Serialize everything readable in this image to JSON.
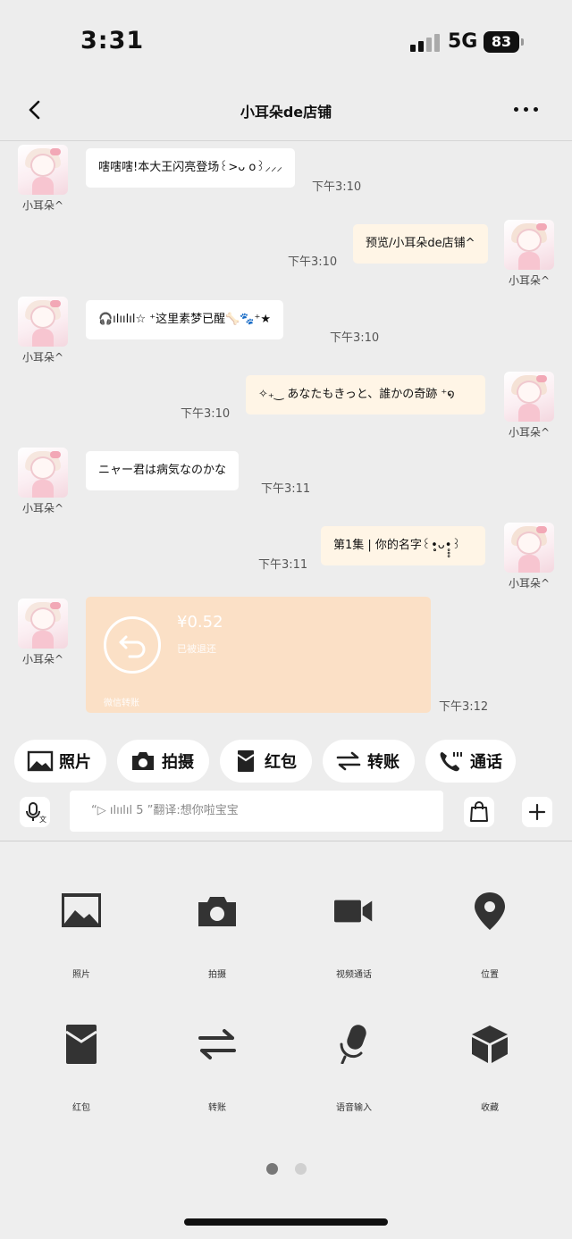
{
  "status": {
    "time": "3:31",
    "network": "5G",
    "battery": "83"
  },
  "nav": {
    "title": "小耳朵de店铺"
  },
  "messages": [
    {
      "side": "in",
      "name": "小耳朵^",
      "text": "嗐嗐嗐!本大王闪亮登场꒰>ᴗ o꒱⸝⸝⸝",
      "time": "下午3:10"
    },
    {
      "side": "out",
      "name": "小耳朵^",
      "text": "预览/小耳朵de店铺^",
      "time": "下午3:10"
    },
    {
      "side": "in",
      "name": "小耳朵^",
      "text": "🎧ılıılıl☆ ⁺这里素梦已醒🦴🐾⁺★",
      "time": "下午3:10"
    },
    {
      "side": "out",
      "name": "小耳朵^",
      "text": "✧₊‿ あなたもきっと、誰かの奇跡 ⁺໑",
      "time": "下午3:10"
    },
    {
      "side": "in",
      "name": "小耳朵^",
      "text": "ニャー君は病気なのかな",
      "time": "下午3:11"
    },
    {
      "side": "out",
      "name": "小耳朵^",
      "text": "第1集 | 你的名字꒰•̥̥̥ᴗ•̥̥̥꒱",
      "time": "下午3:11"
    }
  ],
  "transfer": {
    "name": "小耳朵^",
    "amount": "¥0.52",
    "status": "已被退还",
    "brand": "微信转账",
    "time": "下午3:12"
  },
  "quick_actions": [
    {
      "label": "照片",
      "icon": "photo-icon"
    },
    {
      "label": "拍摄",
      "icon": "camera-icon"
    },
    {
      "label": "红包",
      "icon": "red-packet-icon"
    },
    {
      "label": "转账",
      "icon": "transfer-icon"
    },
    {
      "label": "通话",
      "icon": "phone-icon"
    }
  ],
  "input": {
    "text": "“▷ ılıılıl 5 ”翻译:想你啦宝宝"
  },
  "panel": [
    {
      "label": "照片",
      "icon": "photo-icon"
    },
    {
      "label": "拍摄",
      "icon": "camera-icon"
    },
    {
      "label": "视频通话",
      "icon": "video-call-icon"
    },
    {
      "label": "位置",
      "icon": "location-icon"
    },
    {
      "label": "红包",
      "icon": "red-packet-icon"
    },
    {
      "label": "转账",
      "icon": "transfer-icon"
    },
    {
      "label": "语音输入",
      "icon": "microphone-icon"
    },
    {
      "label": "收藏",
      "icon": "favorites-cube-icon"
    }
  ],
  "pager": {
    "pages": 2,
    "current": 1
  },
  "colors": {
    "background": "#ededed",
    "in_bubble": "#ffffff",
    "out_bubble": "#fff5e6",
    "transfer": "#fbe0c6",
    "icon": "#333333"
  }
}
